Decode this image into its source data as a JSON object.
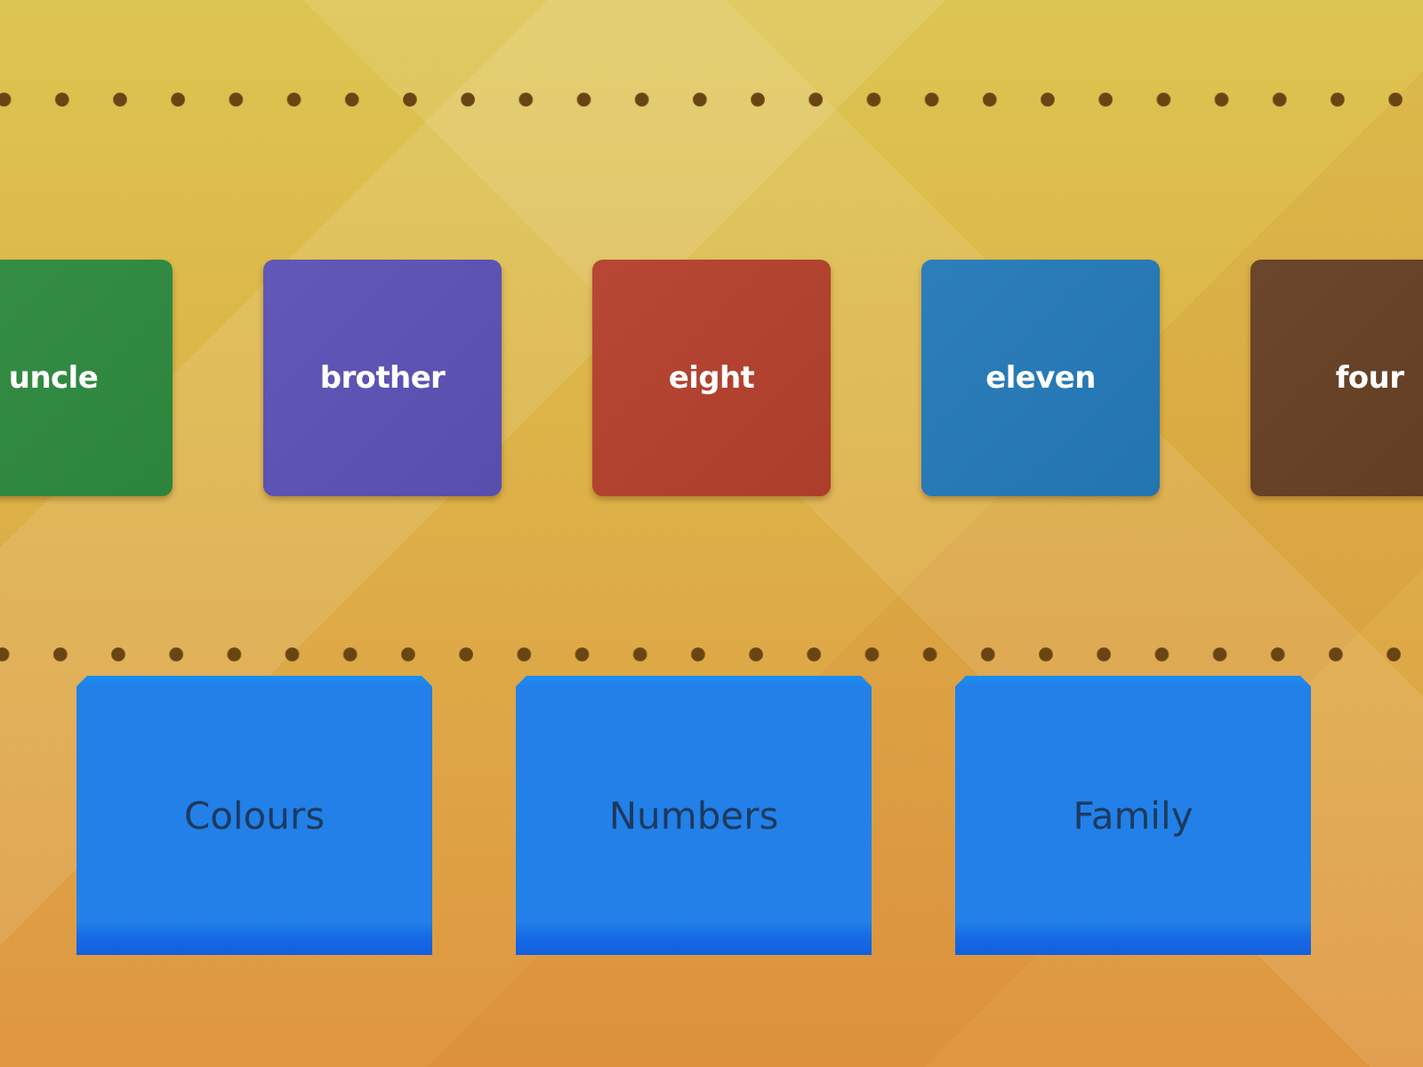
{
  "cards": [
    {
      "label": "uncle",
      "color": "#2e8a3f"
    },
    {
      "label": "brother",
      "color": "#5b51b4"
    },
    {
      "label": "eight",
      "color": "#b4402c"
    },
    {
      "label": "eleven",
      "color": "#2479b7"
    },
    {
      "label": "four",
      "color": "#653f23"
    }
  ],
  "bins": [
    {
      "label": "Colours"
    },
    {
      "label": "Numbers"
    },
    {
      "label": "Family"
    }
  ]
}
